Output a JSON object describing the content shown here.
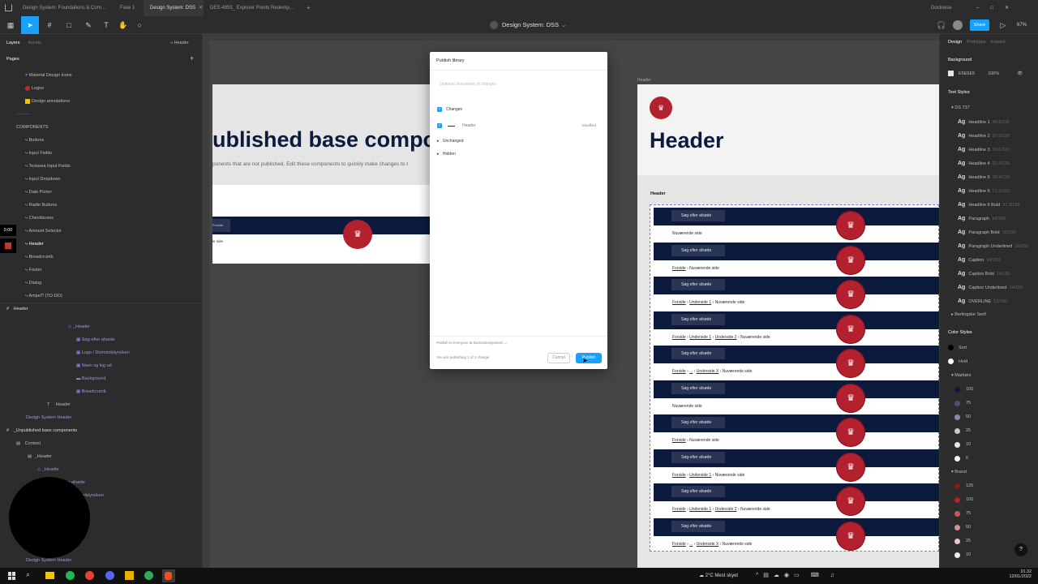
{
  "tabs": {
    "t1": "Design System: Foundations & Com...",
    "t2": "Fase 1",
    "t3": "Design System: DSS",
    "t4": "DES-4855_ Explorer Points Redemp...",
    "right": "Dockwise"
  },
  "toolbar": {
    "file_title": "Design System: DSS",
    "share": "Share",
    "zoom": "67%"
  },
  "left": {
    "tab_layers": "Layers",
    "tab_assets": "Assets",
    "breadcrumb": "Header",
    "pages_label": "Pages",
    "pages": [
      "Material Design Icons",
      "Logos",
      "Design annotations"
    ],
    "separator": "---------",
    "components_label": "COMPONENTS",
    "components": [
      "Buttons",
      "Input Fields",
      "Textarea Input Fields",
      "Input Dropdown",
      "Date Picker",
      "Radio Buttons",
      "Checkboxes",
      "Amount Selector",
      "Header",
      "Breadcrumb",
      "Footer",
      "Dialog",
      "Ampel? (TO-DO)"
    ],
    "layers_root": "Header",
    "layers": [
      "_Header",
      "Søg efter afsøde",
      "Logo / Domstolstyrelsen",
      "Navn og log ud",
      "Background",
      "Breadcrumb",
      "Header",
      "Design System Header",
      "_Unpublished base components",
      "Content",
      "_Header",
      "_Header",
      "ter afsøde",
      "tolstyrelsen",
      "Design System Header"
    ],
    "timer": "0:00"
  },
  "canvas": {
    "unpublished_title": "ublished base compo",
    "unpublished_sub": "ponents that are not published. Edit these components to quickly make changes to t",
    "mini_left": "Forside",
    "mini_side": "le side",
    "frame_label": "Header",
    "header_title": "Header",
    "section_label": "Header",
    "search_label": "Søg efter afsøde",
    "crumbs": [
      {
        "parts": [
          "Nuværende side"
        ]
      },
      {
        "parts": [
          "Forside",
          "Nuværende side"
        ]
      },
      {
        "parts": [
          "Forside",
          "Underside 1",
          "Nuværende side"
        ]
      },
      {
        "parts": [
          "Forside",
          "Underside 1",
          "Underside 2",
          "Nuværende side"
        ]
      },
      {
        "parts": [
          "Forside",
          "...",
          "Underside X",
          "Nuværende side"
        ]
      },
      {
        "parts": [
          "Nuværende side"
        ]
      },
      {
        "parts": [
          "Forside",
          "Nuværende side"
        ]
      },
      {
        "parts": [
          "Forside",
          "Underside 1",
          "Nuværende side"
        ]
      },
      {
        "parts": [
          "Forside",
          "Underside 1",
          "Underside 2",
          "Nuværende side"
        ]
      },
      {
        "parts": [
          "Forside",
          "...",
          "Underside X",
          "Nuværende side"
        ]
      }
    ]
  },
  "modal": {
    "title": "Publish library",
    "description_placeholder": "Optional description of changes",
    "changes": "Changes",
    "item_name": "Header",
    "item_status": "Modified",
    "unchanged": "Unchanged",
    "hidden": "Hidden",
    "publish_to": "Publish to everyone at Domstolsstyrelsen",
    "summary": "You are publishing 1 of 1 change",
    "cancel": "Cancel",
    "publish": "Publish"
  },
  "right": {
    "tab_design": "Design",
    "tab_prototype": "Prototype",
    "tab_inspect": "Inspect",
    "background_label": "Background",
    "bg_hex": "E5E5E5",
    "bg_opacity": "100%",
    "text_styles_label": "Text Styles",
    "ds_group": "DS 737",
    "text_styles": [
      {
        "name": "Headline 1",
        "meta": "48.8/116"
      },
      {
        "name": "Headline 2",
        "meta": "37.5/120"
      },
      {
        "name": "Headline 3",
        "meta": "30.5/120"
      },
      {
        "name": "Headline 4",
        "meta": "31.5/120"
      },
      {
        "name": "Headline 5",
        "meta": "28.4/120"
      },
      {
        "name": "Headline 6",
        "meta": "21.3/150"
      },
      {
        "name": "Headline 6 Bold",
        "meta": "21.3/150"
      },
      {
        "name": "Paragraph",
        "meta": "16/150"
      },
      {
        "name": "Paragraph Bold",
        "meta": "16/150"
      },
      {
        "name": "Paragraph Underlined",
        "meta": "16/150"
      },
      {
        "name": "Caption",
        "meta": "14/150"
      },
      {
        "name": "Caption Bold",
        "meta": "14/150"
      },
      {
        "name": "Caption Underlined",
        "meta": "14/150"
      },
      {
        "name": "OVERLINE",
        "meta": "12/150"
      }
    ],
    "berlingske": "Berlingske Serif",
    "color_styles_label": "Color Styles",
    "sort": "Sort",
    "hvid": "Hvid",
    "markoera": "Markørs",
    "marker_swatches": [
      {
        "label": "100",
        "color": "#0c1a3e"
      },
      {
        "label": "75",
        "color": "#48526f"
      },
      {
        "label": "50",
        "color": "#858c9f"
      },
      {
        "label": "25",
        "color": "#c2c6cf"
      },
      {
        "label": "10",
        "color": "#e7e8ec"
      },
      {
        "label": "5",
        "color": "#f3f4f5"
      }
    ],
    "brand": "Brand",
    "brand_swatches": [
      {
        "label": "125",
        "color": "#8a1822"
      },
      {
        "label": "100",
        "color": "#b3202e"
      },
      {
        "label": "75",
        "color": "#c6585f"
      },
      {
        "label": "50",
        "color": "#d98f94"
      },
      {
        "label": "25",
        "color": "#ecc7ca"
      },
      {
        "label": "10",
        "color": "#f7e9ea"
      }
    ]
  },
  "taskbar": {
    "weather": "2°C  Mest skyet",
    "time": "10.32",
    "date": "12/01/2022"
  }
}
